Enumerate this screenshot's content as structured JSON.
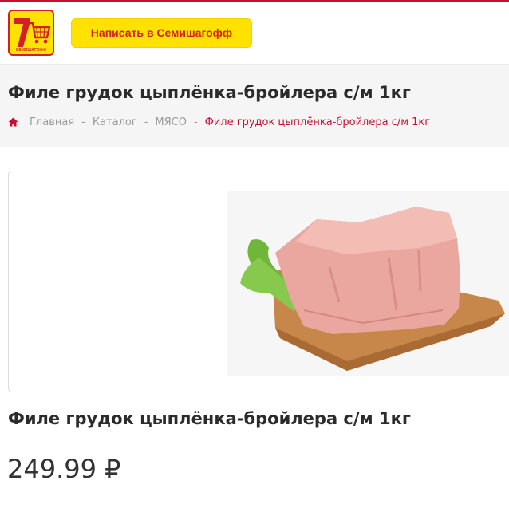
{
  "header": {
    "logo_icon": "semishagoff-7-cart-logo",
    "logo_caption": "СЕМИШАГОФФ",
    "write_button_label": "Написать в Семишагофф"
  },
  "title_band": {
    "title": "Филе грудок цыплёнка-бройлера с/м 1кг",
    "breadcrumb": {
      "home_icon": "home-icon",
      "items": [
        "Главная",
        "Каталог",
        "МЯСО"
      ],
      "separator": "-",
      "current": "Филе грудок цыплёнка-бройлера с/м 1кг"
    }
  },
  "product": {
    "image_icon": "chicken-breast-fillet-photo",
    "name": "Филе грудок цыплёнка-бройлера с/м 1кг",
    "price": "249.99 ₽"
  },
  "colors": {
    "brand_red": "#c8102e",
    "brand_yellow": "#ffe200",
    "muted_text": "#9a9a9a"
  }
}
